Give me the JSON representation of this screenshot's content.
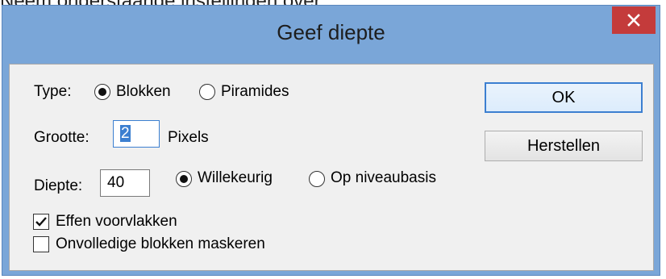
{
  "page_heading": "Neem onderstaande instellingen over:",
  "window": {
    "title": "Geef diepte",
    "close_symbol": "×"
  },
  "type": {
    "label": "Type:",
    "options": [
      {
        "label": "Blokken",
        "selected": true
      },
      {
        "label": "Piramides",
        "selected": false
      }
    ]
  },
  "grootte": {
    "label": "Grootte:",
    "value": "2",
    "unit": "Pixels"
  },
  "diepte": {
    "label": "Diepte:",
    "value": "40",
    "options": [
      {
        "label": "Willekeurig",
        "selected": true
      },
      {
        "label": "Op niveaubasis",
        "selected": false
      }
    ]
  },
  "checkboxes": [
    {
      "label": "Effen voorvlakken",
      "checked": true
    },
    {
      "label": "Onvolledige blokken maskeren",
      "checked": false
    }
  ],
  "buttons": {
    "ok": "OK",
    "reset": "Herstellen"
  },
  "colors": {
    "titlebar": "#7aa6d8",
    "close": "#c43b3b",
    "accent": "#3c7fd0",
    "dialog_bg": "#f0f0f0"
  }
}
